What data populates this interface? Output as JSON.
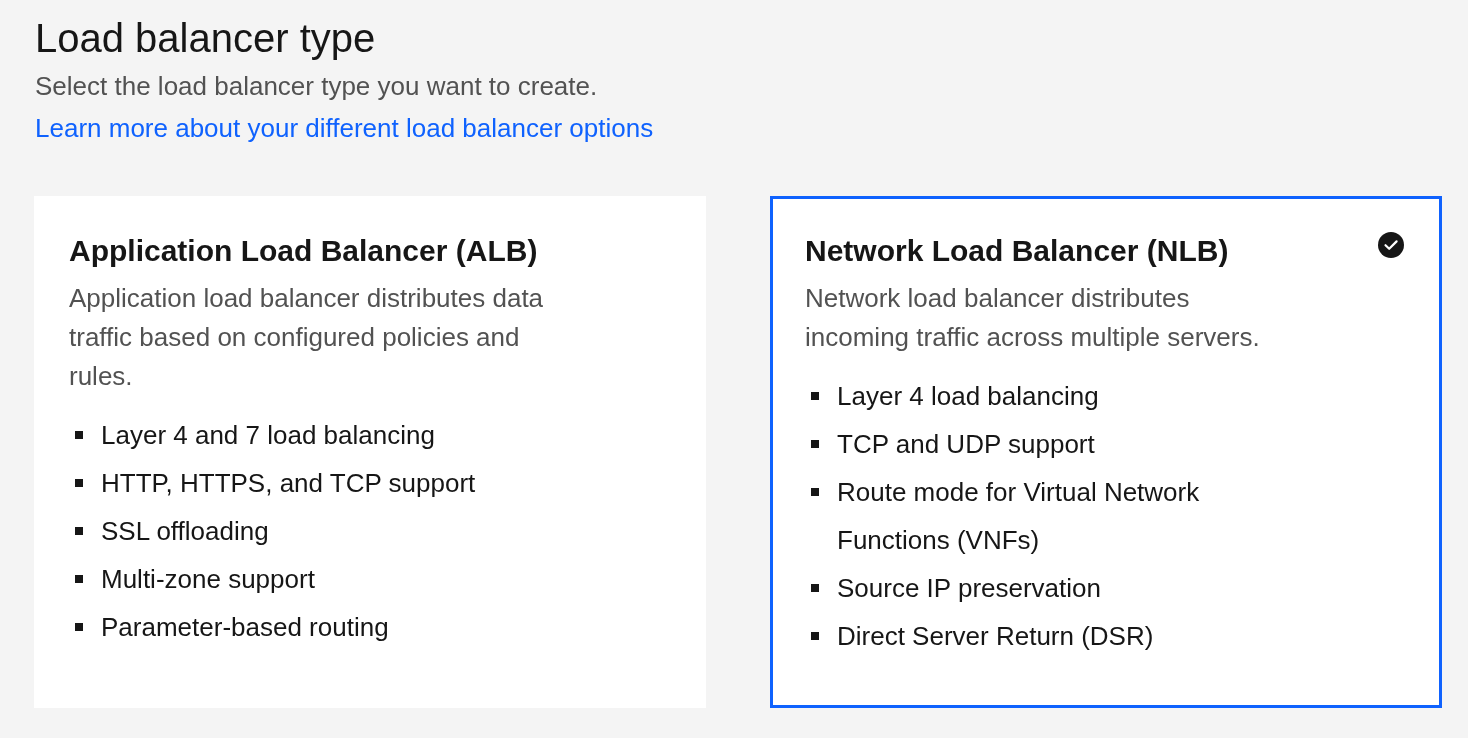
{
  "section": {
    "title": "Load balancer type",
    "description": "Select the load balancer type you want to create.",
    "link": "Learn more about your different load balancer options"
  },
  "cards": [
    {
      "title": "Application Load Balancer (ALB)",
      "description": "Application load balancer distributes data traffic based on configured policies and rules.",
      "features": [
        "Layer 4 and 7 load balancing",
        "HTTP, HTTPS, and TCP support",
        "SSL offloading",
        "Multi-zone support",
        "Parameter-based routing"
      ],
      "selected": false
    },
    {
      "title": "Network Load Balancer (NLB)",
      "description": "Network load balancer distributes incoming traffic across multiple servers.",
      "features": [
        "Layer 4 load balancing",
        "TCP and UDP support",
        "Route mode for Virtual Network Functions (VNFs)",
        "Source IP preservation",
        "Direct Server Return (DSR)"
      ],
      "selected": true
    }
  ]
}
